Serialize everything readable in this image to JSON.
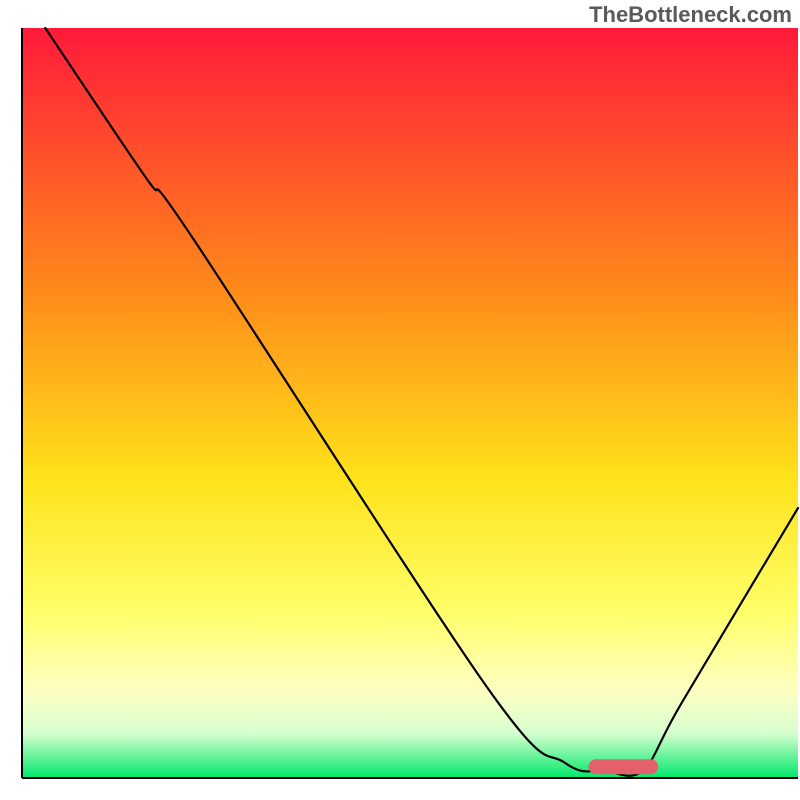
{
  "watermark": "TheBottleneck.com",
  "chart_data": {
    "type": "line",
    "title": "",
    "xlabel": "",
    "ylabel": "",
    "xlim": [
      0,
      100
    ],
    "ylim": [
      0,
      100
    ],
    "gradient_stops": [
      {
        "offset": 0,
        "color": "#ff1a3a"
      },
      {
        "offset": 35,
        "color": "#ff8a1a"
      },
      {
        "offset": 60,
        "color": "#ffe21a"
      },
      {
        "offset": 78,
        "color": "#ffff6a"
      },
      {
        "offset": 88,
        "color": "#ffffc0"
      },
      {
        "offset": 94,
        "color": "#d8ffd0"
      },
      {
        "offset": 100,
        "color": "#00e86b"
      }
    ],
    "series": [
      {
        "name": "bottleneck-curve",
        "color": "#000000",
        "points": [
          {
            "x": 3,
            "y": 100
          },
          {
            "x": 16,
            "y": 80
          },
          {
            "x": 22,
            "y": 72
          },
          {
            "x": 60,
            "y": 12
          },
          {
            "x": 70,
            "y": 2
          },
          {
            "x": 75,
            "y": 1
          },
          {
            "x": 80,
            "y": 1
          },
          {
            "x": 85,
            "y": 10
          },
          {
            "x": 100,
            "y": 36
          }
        ]
      }
    ],
    "marker": {
      "color": "#e4616c",
      "x_start": 73,
      "x_end": 82,
      "y": 1.5,
      "height": 2
    },
    "axis": {
      "color": "#000000",
      "width": 2
    }
  }
}
